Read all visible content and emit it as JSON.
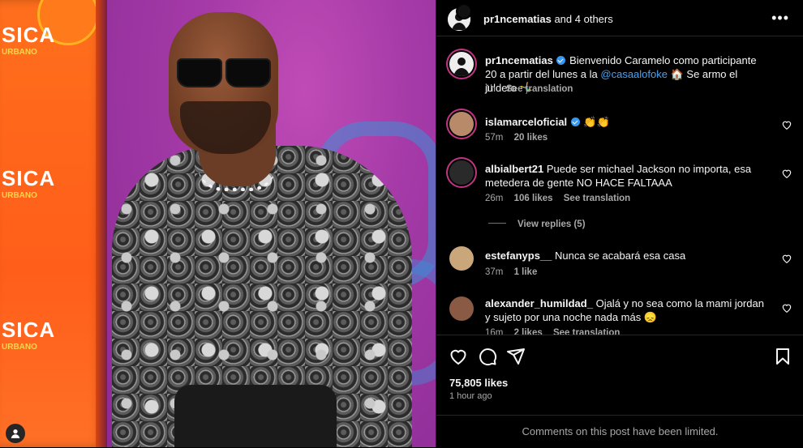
{
  "post": {
    "header": {
      "username": "pr1ncematias",
      "others": "and 4 others",
      "more_icon": "more-horizontal-icon"
    },
    "caption": {
      "username": "pr1ncematias",
      "text_1": "Bienvenido Caramelo como participante 20 a partir del lunes a la",
      "mention": "@casaalofoke",
      "text_2": "🏠 Se armo el juldero 🤸‍♂️",
      "time": "1h",
      "see_translation": "See translation"
    },
    "comments": [
      {
        "username": "islamarceloficial",
        "verified": true,
        "text": "👏👏",
        "time": "57m",
        "likes": "20 likes",
        "extra": ""
      },
      {
        "username": "albialbert21",
        "verified": false,
        "text": "Puede ser michael Jackson no importa, esa metedera de gente NO HACE FALTAAA",
        "time": "26m",
        "likes": "106 likes",
        "extra": "See translation",
        "replies": "View replies (5)"
      },
      {
        "username": "estefanyps__",
        "verified": false,
        "text": "Nunca se acabará esa casa",
        "time": "37m",
        "likes": "1 like",
        "extra": ""
      },
      {
        "username": "alexander_humildad_",
        "verified": false,
        "text": "Ojalá y no sea como la mami jordan y sujeto por una noche nada más 😞",
        "time": "16m",
        "likes": "2 likes",
        "extra": "See translation"
      }
    ],
    "actions": {
      "like_icon": "heart-icon",
      "comment_icon": "comment-icon",
      "share_icon": "send-icon",
      "save_icon": "bookmark-icon"
    },
    "likes": "75,805 likes",
    "posted_ago": "1 hour ago",
    "limited_notice": "Comments on this post have been limited."
  },
  "colors": {
    "background": "#000000",
    "text": "#f5f5f5",
    "secondary_text": "#a8a8a8",
    "link": "#4aa2f0",
    "verified": "#3897f0"
  }
}
